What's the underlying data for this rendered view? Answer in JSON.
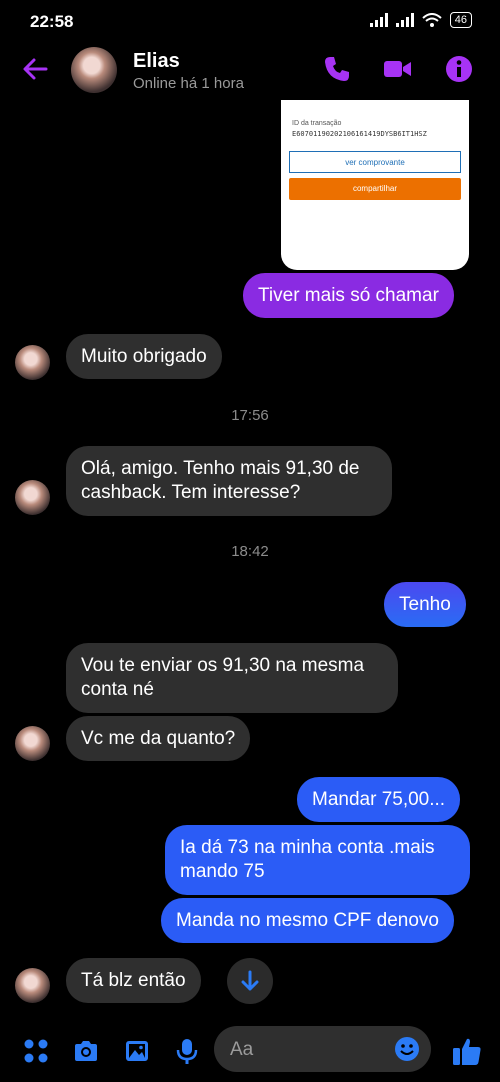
{
  "status": {
    "time": "22:58",
    "battery": "46"
  },
  "header": {
    "contact_name": "Elias",
    "presence": "Online há 1 hora"
  },
  "receipt": {
    "id_label": "ID da transação",
    "transaction_id": "E60701190202106161419DYSB6IT1HSZ",
    "view_button": "ver comprovante",
    "share_button": "compartilhar"
  },
  "messages": [
    "Tiver mais só chamar",
    "Muito obrigado",
    "Olá, amigo. Tenho mais 91,30 de cashback. Tem interesse?",
    "Tenho",
    "Vou te enviar os 91,30 na mesma conta né",
    "Vc me da quanto?",
    "Mandar 75,00...",
    "Ia dá 73 na minha conta .mais mando 75",
    "Manda no mesmo CPF denovo",
    "Tá blz então"
  ],
  "timestamps": [
    "17:56",
    "18:42"
  ],
  "composer": {
    "placeholder": "Aa"
  },
  "colors": {
    "accent": "#a733f5",
    "outgoing_blue": "#2b5cf6",
    "incoming": "#2f2f2f"
  }
}
